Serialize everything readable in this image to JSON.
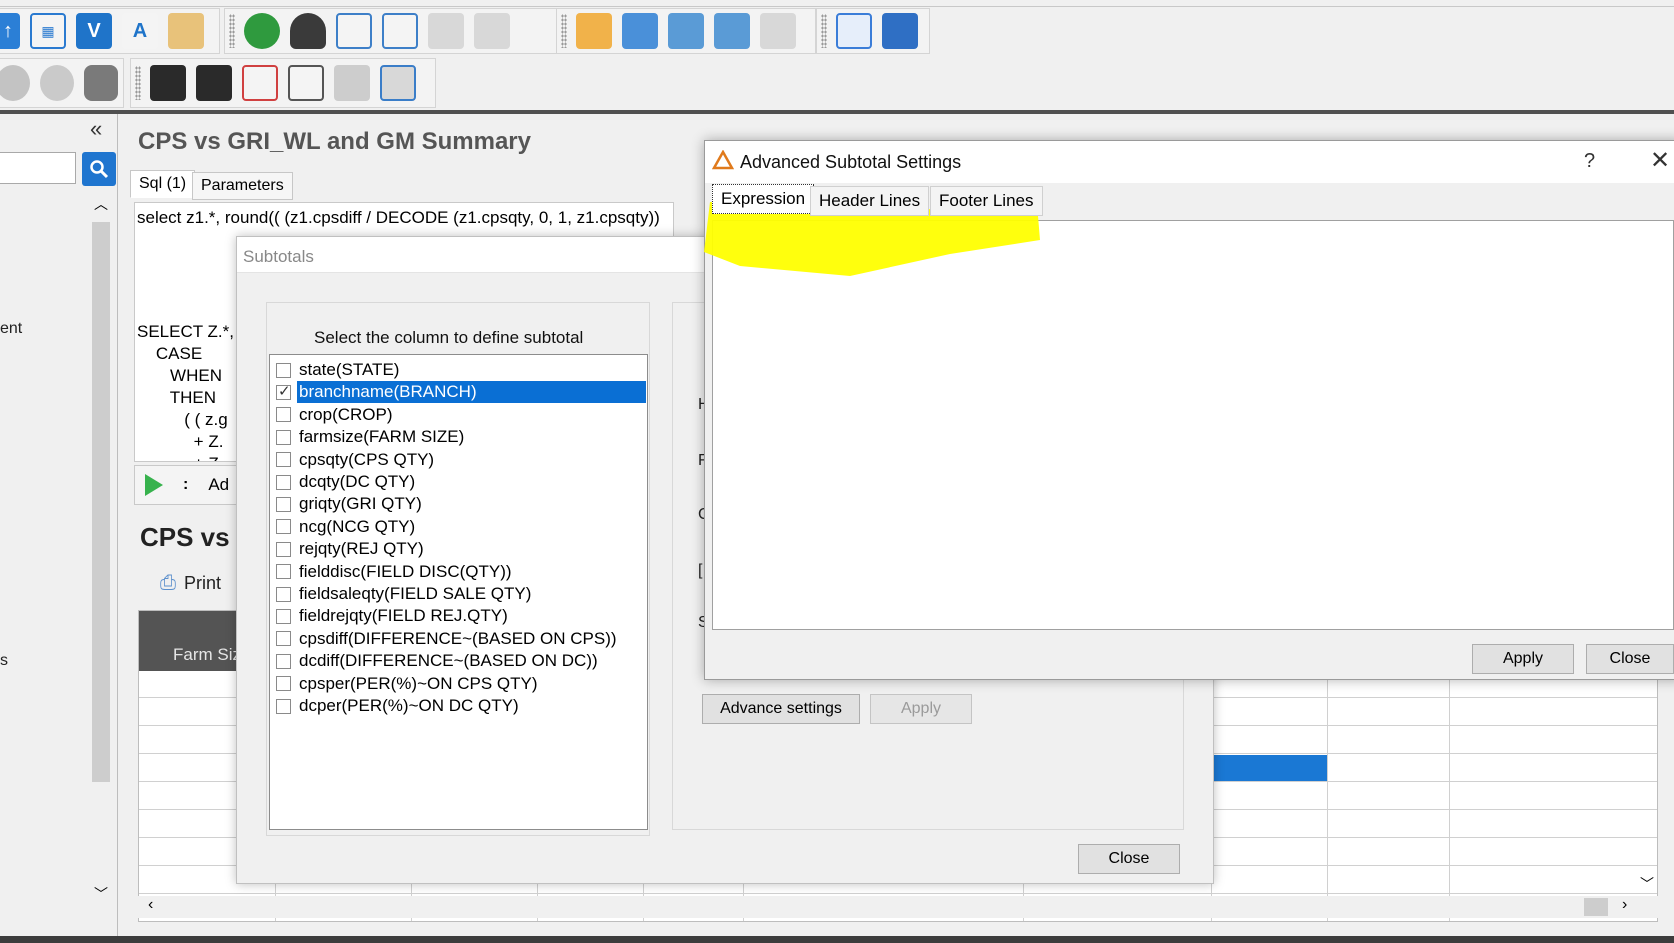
{
  "main": {
    "title": "CPS vs GRI_WL and GM Summary",
    "tabs": [
      {
        "label": "Sql (1)"
      },
      {
        "label": "Parameters"
      }
    ],
    "sql_lines": [
      "select z1.*, round(( (z1.cpsdiff / DECODE (z1.cpsqty, 0, 1, z1.cpsqty))",
      "SELECT Z.*,",
      "    CASE",
      "       WHEN",
      "       THEN",
      "          ( ( z.g",
      "            + Z.",
      "            + Z."
    ],
    "sql_toolbar_frag_1": ":",
    "sql_toolbar_frag_2": "Ad",
    "report_title": "CPS vs G",
    "print_label": "Print",
    "grid_header_label": "Farm Siz"
  },
  "left_panel": {
    "frag_1": "ent",
    "frag_2": "s"
  },
  "subtotals_dialog": {
    "title": "Subtotals",
    "list_label": "Select the column to define subtotal",
    "columns": [
      {
        "label": "state(STATE)",
        "checked": false
      },
      {
        "label": "branchname(BRANCH)",
        "checked": true,
        "selected": true
      },
      {
        "label": "crop(CROP)",
        "checked": false
      },
      {
        "label": "farmsize(FARM SIZE)",
        "checked": false
      },
      {
        "label": "cpsqty(CPS QTY)",
        "checked": false
      },
      {
        "label": "dcqty(DC QTY)",
        "checked": false
      },
      {
        "label": "griqty(GRI QTY)",
        "checked": false
      },
      {
        "label": "ncg(NCG QTY)",
        "checked": false
      },
      {
        "label": "rejqty(REJ QTY)",
        "checked": false
      },
      {
        "label": "fielddisc(FIELD DISC(QTY))",
        "checked": false
      },
      {
        "label": "fieldsaleqty(FIELD SALE QTY)",
        "checked": false
      },
      {
        "label": "fieldrejqty(FIELD REJ.QTY)",
        "checked": false
      },
      {
        "label": "cpsdiff(DIFFERENCE~(BASED ON CPS))",
        "checked": false
      },
      {
        "label": "dcdiff(DIFFERENCE~(BASED ON DC))",
        "checked": false
      },
      {
        "label": "cpsper(PER(%)~ON CPS QTY)",
        "checked": false
      },
      {
        "label": "dcper(PER(%)~ON DC QTY)",
        "checked": false
      }
    ],
    "right_frags": [
      "H",
      "F",
      "C",
      "[",
      "S"
    ],
    "advance_settings_label": "Advance settings",
    "apply_label": "Apply",
    "close_label": "Close"
  },
  "advanced_dialog": {
    "title": "Advanced Subtotal Settings",
    "help_label": "?",
    "close_icon_label": "✕",
    "tabs": [
      {
        "label": "Expression"
      },
      {
        "label": "Header Lines"
      },
      {
        "label": "Footer Lines"
      }
    ],
    "apply_label": "Apply",
    "close_label": "Close"
  },
  "colors": {
    "selection": "#0a6fd4",
    "highlight": "#ffff00",
    "search_button": "#1f75cf",
    "grid_header": "#545454"
  }
}
